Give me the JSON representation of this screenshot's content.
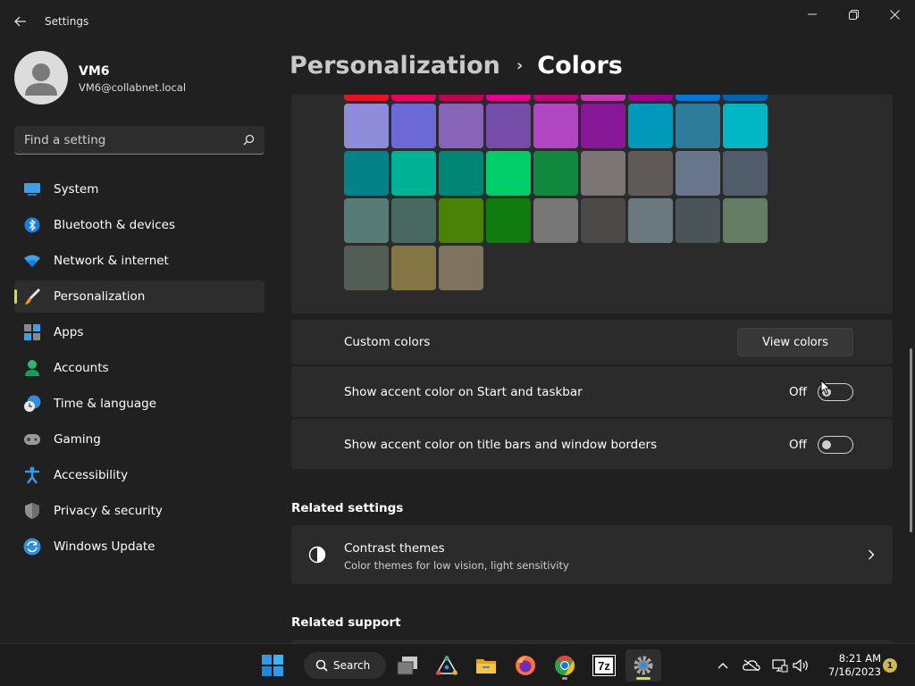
{
  "window": {
    "title": "Settings"
  },
  "profile": {
    "name": "VM6",
    "email": "VM6@collabnet.local"
  },
  "search": {
    "placeholder": "Find a setting"
  },
  "sidebar": {
    "items": [
      {
        "label": "System",
        "icon": "system-icon",
        "selected": false
      },
      {
        "label": "Bluetooth & devices",
        "icon": "bluetooth-icon",
        "selected": false
      },
      {
        "label": "Network & internet",
        "icon": "wifi-icon",
        "selected": false
      },
      {
        "label": "Personalization",
        "icon": "brush-icon",
        "selected": true
      },
      {
        "label": "Apps",
        "icon": "apps-icon",
        "selected": false
      },
      {
        "label": "Accounts",
        "icon": "person-icon",
        "selected": false
      },
      {
        "label": "Time & language",
        "icon": "clock-globe-icon",
        "selected": false
      },
      {
        "label": "Gaming",
        "icon": "gamepad-icon",
        "selected": false
      },
      {
        "label": "Accessibility",
        "icon": "accessibility-icon",
        "selected": false
      },
      {
        "label": "Privacy & security",
        "icon": "shield-icon",
        "selected": false
      },
      {
        "label": "Windows Update",
        "icon": "update-icon",
        "selected": false
      }
    ],
    "accent_color": "#c7d879"
  },
  "header": {
    "parent": "Personalization",
    "separator": "›",
    "current": "Colors"
  },
  "accent_swatches": {
    "rows": [
      [
        "#e81123",
        "#ea005e",
        "#c30052",
        "#e3008c",
        "#bf0077",
        "#c239b3",
        "#9a0089",
        "#0078d7",
        "#0063b1"
      ],
      [
        "#8e8cd8",
        "#6b69d6",
        "#8764b8",
        "#744da9",
        "#b146c2",
        "#881798",
        "#0099bc",
        "#2d7d9a",
        "#00b7c3"
      ],
      [
        "#038387",
        "#00b294",
        "#018574",
        "#00cc6a",
        "#10893e",
        "#7a7574",
        "#5d5a58",
        "#68768a",
        "#515c6b"
      ],
      [
        "#567c73",
        "#486860",
        "#498205",
        "#107c10",
        "#767676",
        "#4c4a48",
        "#69797e",
        "#4a5459",
        "#647c64"
      ],
      [
        "#525e54",
        "#847545",
        "#7e735f"
      ]
    ]
  },
  "custom_colors": {
    "label": "Custom colors",
    "button": "View colors"
  },
  "toggles": [
    {
      "label": "Show accent color on Start and taskbar",
      "state": "Off"
    },
    {
      "label": "Show accent color on title bars and window borders",
      "state": "Off"
    }
  ],
  "related_settings": {
    "title": "Related settings",
    "items": [
      {
        "title": "Contrast themes",
        "subtitle": "Color themes for low vision, light sensitivity",
        "icon": "contrast-icon"
      }
    ]
  },
  "related_support": {
    "title": "Related support"
  },
  "taskbar": {
    "search_label": "Search",
    "apps": [
      "windows-start-icon",
      "task-view-icon",
      "network-app-icon",
      "file-explorer-icon",
      "firefox-icon",
      "chrome-icon",
      "7zip-icon",
      "settings-icon"
    ],
    "seven_zip_text": "7z",
    "time": "8:21 AM",
    "date": "7/16/2023",
    "notification_count": "1"
  }
}
